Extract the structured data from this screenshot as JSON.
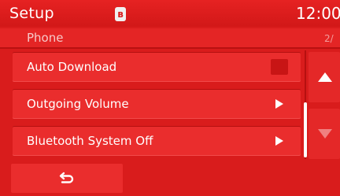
{
  "header": {
    "title": "Setup",
    "bluetooth_badge": "ʙ",
    "clock": "12:00"
  },
  "subheader": {
    "section": "Phone",
    "page_indicator": "2/"
  },
  "menu": {
    "items": [
      {
        "label": "Auto Download",
        "control": "checkbox",
        "checked": false
      },
      {
        "label": "Outgoing Volume",
        "control": "submenu-arrow"
      },
      {
        "label": "Bluetooth System Off",
        "control": "submenu-arrow"
      }
    ]
  },
  "scroll": {
    "up_icon": "triangle-up-icon",
    "down_icon": "triangle-down-icon",
    "down_enabled": false
  },
  "footer": {
    "back_icon": "back-arrow-icon"
  },
  "colors": {
    "background": "#d91c1c",
    "row": "#ea2d2d",
    "text": "#ffffff"
  }
}
